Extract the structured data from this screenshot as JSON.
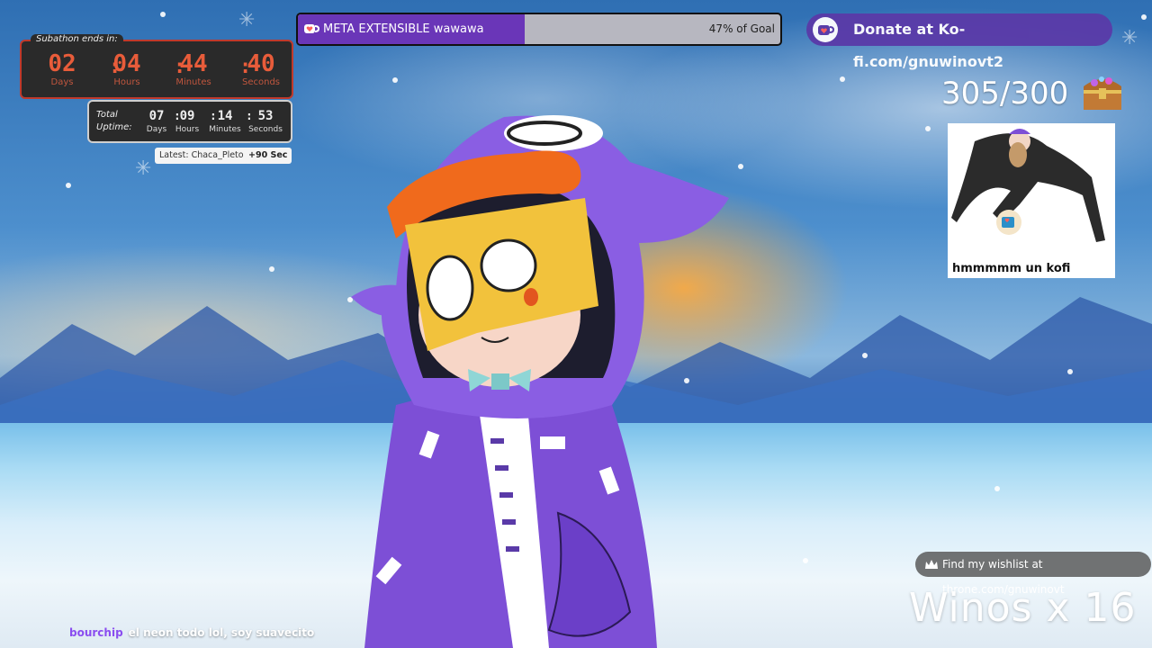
{
  "subathon": {
    "label": "Subathon ends in:",
    "days": "02",
    "hours": "04",
    "minutes": "44",
    "seconds": "40",
    "units": {
      "days": "Days",
      "hours": "Hours",
      "minutes": "Minutes",
      "seconds": "Seconds"
    }
  },
  "uptime": {
    "label_line1": "Total",
    "label_line2": "Uptime:",
    "days": "07",
    "hours": "09",
    "minutes": "14",
    "seconds": "53",
    "units": {
      "days": "Days",
      "hours": "Hours",
      "minutes": "Minutes",
      "seconds": "Seconds"
    }
  },
  "latest": {
    "text": "Latest: Chaca_Pleto",
    "bonus": "+90 Sec"
  },
  "goal": {
    "title": "META EXTENSIBLE wawawa",
    "percent_text": "47% of Goal",
    "progress": 0.47,
    "fill_color": "#6a36b8",
    "icon": "kofi-heart-cup-icon"
  },
  "kofi": {
    "text": "Donate at Ko-fi.com/gnuwinovt2",
    "icon": "kofi-cup-icon"
  },
  "counter": {
    "text": "305/300",
    "icon": "treasure-chest-icon"
  },
  "alert": {
    "caption": "hmmmmm un kofi"
  },
  "wishlist": {
    "text": "Find my wishlist at throne.com/gnuwinovt",
    "icon": "crown-icon"
  },
  "winos": {
    "text": "Winos x 16"
  },
  "chat": {
    "user": "bourchip",
    "message": "el neon todo lol, soy suavecito"
  },
  "colors": {
    "timer_accent": "#e85c3a",
    "kofi_bg": "#5a3aa8",
    "chat_user": "#8a4df0"
  }
}
